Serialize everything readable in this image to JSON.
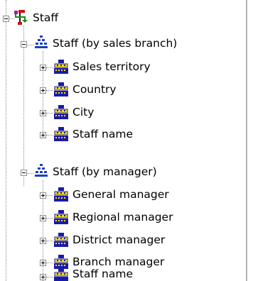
{
  "tree": {
    "root": {
      "label": "Staff",
      "icon": "hierarchy-root-icon",
      "expanded": true
    },
    "hierarchies": [
      {
        "label": "Staff (by sales branch)",
        "icon": "hierarchy-icon",
        "expanded": true,
        "levels": [
          {
            "label": "Sales territory",
            "icon": "level-icon",
            "expanded": false
          },
          {
            "label": "Country",
            "icon": "level-icon",
            "expanded": false
          },
          {
            "label": "City",
            "icon": "level-icon",
            "expanded": false
          },
          {
            "label": "Staff name",
            "icon": "level-icon",
            "expanded": false
          }
        ]
      },
      {
        "label": "Staff (by manager)",
        "icon": "hierarchy-icon",
        "expanded": true,
        "levels": [
          {
            "label": "General manager",
            "icon": "level-icon",
            "expanded": false
          },
          {
            "label": "Regional manager",
            "icon": "level-icon",
            "expanded": false
          },
          {
            "label": "District manager",
            "icon": "level-icon",
            "expanded": false
          },
          {
            "label": "Branch manager",
            "icon": "level-icon",
            "expanded": false
          },
          {
            "label": "Staff name",
            "icon": "level-icon",
            "expanded": false
          }
        ]
      }
    ]
  },
  "colors": {
    "level_icon_yellow": "#ffe600",
    "level_icon_blue": "#1a1aa8",
    "hierarchy_icon_blue": "#1f3fbf",
    "root_icon_purple": "#a0208f",
    "root_icon_green": "#1a8a1a",
    "root_icon_red": "#d01010"
  }
}
